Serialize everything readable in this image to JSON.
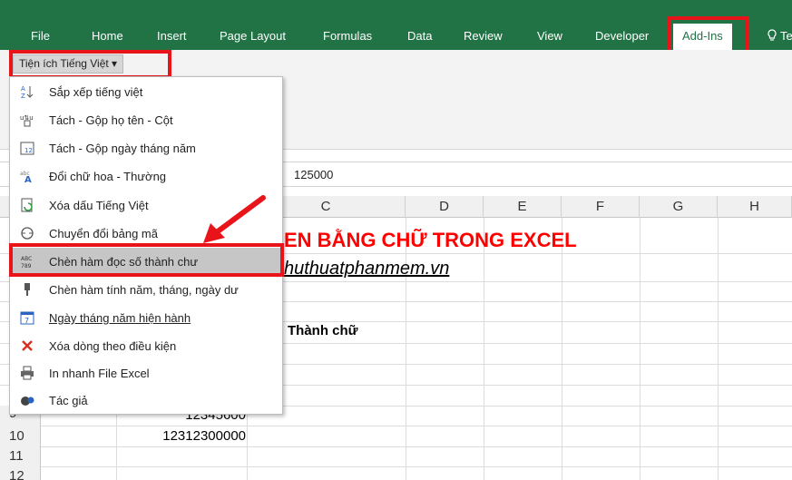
{
  "tabs": [
    {
      "label": "File"
    },
    {
      "label": "Home"
    },
    {
      "label": "Insert"
    },
    {
      "label": "Page Layout"
    },
    {
      "label": "Formulas"
    },
    {
      "label": "Data"
    },
    {
      "label": "Review"
    },
    {
      "label": "View"
    },
    {
      "label": "Developer"
    },
    {
      "label": "Add-Ins",
      "active": true
    }
  ],
  "tell_me_icon": "lightbulb-icon",
  "tell_me_text": "Te",
  "addin_button": {
    "label": "Tiện ích Tiếng Việt ▾"
  },
  "formula_bar": {
    "value": "125000"
  },
  "columns": [
    "C",
    "D",
    "E",
    "F",
    "G",
    "H"
  ],
  "rows": [
    "9",
    "10",
    "11",
    "12"
  ],
  "cells": {
    "title": "EN BẰNG CHỮ TRONG EXCEL",
    "link": "huthuatphanmem.vn",
    "header_text": "Thành chữ",
    "row9_value": "12345600",
    "row10_value": "12312300000"
  },
  "menu": [
    {
      "icon": "sort-az-icon",
      "label": "Sắp xếp tiếng việt"
    },
    {
      "icon": "split-merge-name-icon",
      "label": "Tách - Gộp họ tên - Cột"
    },
    {
      "icon": "calendar-12-icon",
      "label": "Tách - Gộp ngày tháng năm"
    },
    {
      "icon": "change-case-icon",
      "label": "Đổi chữ hoa - Thường"
    },
    {
      "icon": "remove-accent-icon",
      "label": "Xóa dấu Tiếng Việt"
    },
    {
      "icon": "convert-encoding-icon",
      "label": "Chuyển đổi bảng mã"
    },
    {
      "icon": "number-to-text-icon",
      "label": "Chèn hàm đọc số thành chư",
      "selected": true
    },
    {
      "icon": "function-date-icon",
      "label": "Chèn hàm tính năm, tháng, ngày dư"
    },
    {
      "icon": "calendar-7-icon",
      "label": "Ngày tháng năm hiện hành",
      "underline_first": true
    },
    {
      "icon": "delete-rows-icon",
      "label": "Xóa dòng theo điều kiện"
    },
    {
      "icon": "print-icon",
      "label": "In nhanh File Excel"
    },
    {
      "icon": "author-icon",
      "label": "Tác giả"
    }
  ],
  "colors": {
    "ribbon": "#217346",
    "highlight": "#e8141a",
    "title_red": "#ff0000"
  }
}
